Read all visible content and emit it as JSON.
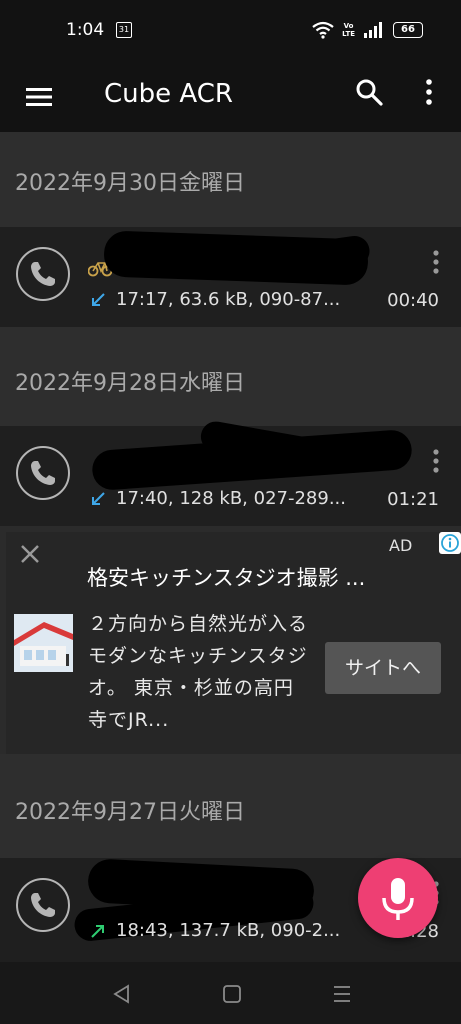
{
  "status_bar": {
    "time": "1:04",
    "calendar_day": "31",
    "battery": "66",
    "volte_top": "Vo",
    "volte_bottom": "LTE"
  },
  "app_bar": {
    "title": "Cube ACR",
    "icons": [
      "menu-icon",
      "search-icon",
      "more-vert-icon"
    ]
  },
  "sections": [
    {
      "date": "2022年9月30日金曜日"
    },
    {
      "date": "2022年9月28日水曜日"
    },
    {
      "date": "2022年9月27日火曜日"
    }
  ],
  "calls": [
    {
      "direction": "incoming",
      "details": "17:17, 63.6 kB, 090-87...",
      "duration": "00:40"
    },
    {
      "direction": "incoming",
      "details": "17:40, 128 kB, 027-289...",
      "duration": "01:21"
    },
    {
      "direction": "outgoing",
      "details": "18:43, 137.7 kB, 090-2...",
      "duration": "01:28"
    }
  ],
  "ad": {
    "label": "AD",
    "title": "格安キッチンスタジオ撮影 ...",
    "body": "２方向から自然光が入るモダンなキッチンスタジオ。 東京・杉並の高円寺でJR...",
    "cta": "サイトへ"
  },
  "colors": {
    "incoming_arrow": "#3fa7e8",
    "outgoing_arrow": "#2ecc71",
    "fab": "#ee3f73"
  }
}
